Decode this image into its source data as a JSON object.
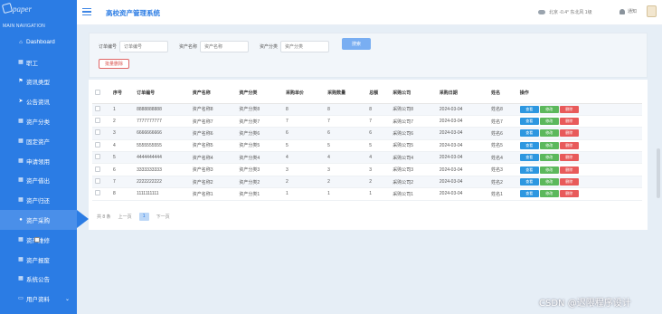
{
  "sidebar": {
    "logo": "paper",
    "nav_header": "MAIN NAVIGATION",
    "items": [
      {
        "label": "Dashboard",
        "icon": "home-icon"
      },
      {
        "label": "职工",
        "icon": "grid-icon"
      },
      {
        "label": "资讯类型",
        "icon": "bookmark-icon"
      },
      {
        "label": "公告资讯",
        "icon": "plane-icon"
      },
      {
        "label": "资产分类",
        "icon": "grid-icon"
      },
      {
        "label": "固定资产",
        "icon": "grid-icon"
      },
      {
        "label": "申请领用",
        "icon": "grid-icon"
      },
      {
        "label": "资产借出",
        "icon": "grid-icon"
      },
      {
        "label": "资产归还",
        "icon": "grid-icon"
      },
      {
        "label": "资产采购",
        "icon": "bulb-icon",
        "active": true
      },
      {
        "label": "资产维修",
        "icon": "grid-icon"
      },
      {
        "label": "资产报废",
        "icon": "grid-icon"
      },
      {
        "label": "系统公告",
        "icon": "grid-icon"
      },
      {
        "label": "用户资料",
        "icon": "user-icon",
        "expandable": true
      }
    ]
  },
  "header": {
    "title": "高校资产管理系统",
    "weather": "北京 -0.4° 东北风 1级",
    "notify": "通知"
  },
  "search": {
    "fields": [
      {
        "label": "订单编号",
        "placeholder": "订单编号"
      },
      {
        "label": "资产名称",
        "placeholder": "资产名称"
      },
      {
        "label": "资产分类",
        "placeholder": "资产分类"
      }
    ],
    "search_button": "搜索",
    "batch_delete": "批量删除"
  },
  "table": {
    "columns": [
      "",
      "序号",
      "订单编号",
      "资产名称",
      "资产分类",
      "采购单价",
      "采购数量",
      "总额",
      "采购公司",
      "采购日期",
      "姓名",
      "操作"
    ],
    "rows": [
      [
        "1",
        "8888888888",
        "资产名称8",
        "资产分类8",
        "8",
        "8",
        "8",
        "采购公司8",
        "2024-03-04",
        "姓名8"
      ],
      [
        "2",
        "7777777777",
        "资产名称7",
        "资产分类7",
        "7",
        "7",
        "7",
        "采购公司7",
        "2024-03-04",
        "姓名7"
      ],
      [
        "3",
        "6666666666",
        "资产名称6",
        "资产分类6",
        "6",
        "6",
        "6",
        "采购公司6",
        "2024-03-04",
        "姓名6"
      ],
      [
        "4",
        "5555555555",
        "资产名称5",
        "资产分类5",
        "5",
        "5",
        "5",
        "采购公司5",
        "2024-03-04",
        "姓名5"
      ],
      [
        "5",
        "4444444444",
        "资产名称4",
        "资产分类4",
        "4",
        "4",
        "4",
        "采购公司4",
        "2024-03-04",
        "姓名4"
      ],
      [
        "6",
        "3333333333",
        "资产名称3",
        "资产分类3",
        "3",
        "3",
        "3",
        "采购公司3",
        "2024-03-04",
        "姓名3"
      ],
      [
        "7",
        "2222222222",
        "资产名称2",
        "资产分类2",
        "2",
        "2",
        "2",
        "采购公司2",
        "2024-03-04",
        "姓名2"
      ],
      [
        "8",
        "1111111111",
        "资产名称1",
        "资产分类1",
        "1",
        "1",
        "1",
        "采购公司1",
        "2024-03-04",
        "姓名1"
      ]
    ],
    "actions": {
      "view": "查看",
      "edit": "修改",
      "delete": "删除"
    }
  },
  "pager": {
    "total": "共 8 条",
    "prev": "上一页",
    "current": "1",
    "next": "下一页"
  },
  "watermark": "CSDN @迟限程序设计"
}
